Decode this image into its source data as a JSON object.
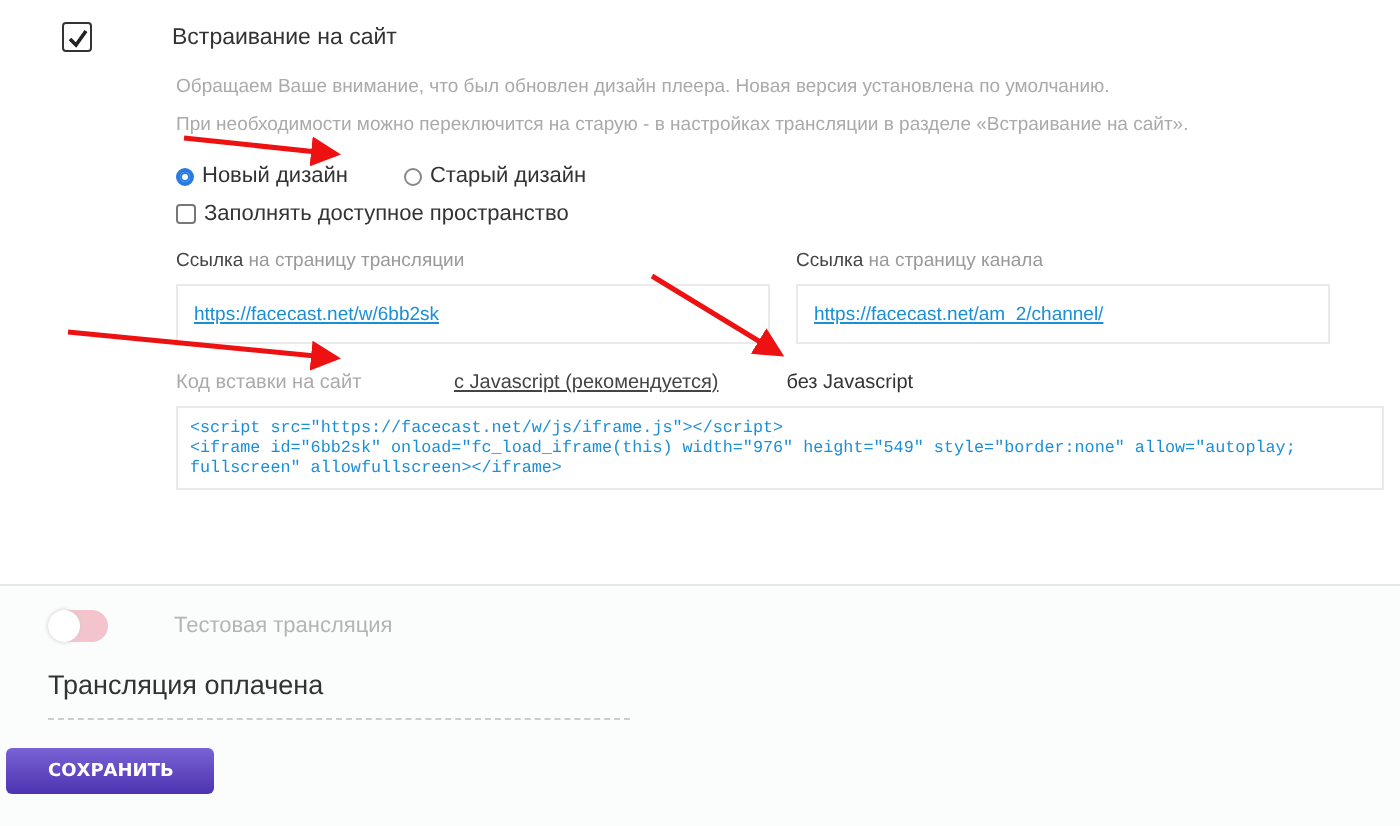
{
  "embed": {
    "checked": true,
    "title": "Встраивание на сайт",
    "notes": [
      "Обращаем Ваше внимание, что был обновлен дизайн плеера. Новая версия установлена по умолчанию.",
      "При необходимости можно переключится на старую - в настройках трансляции в разделе «Встраивание на сайт»."
    ],
    "design_options": [
      {
        "label": "Новый дизайн",
        "selected": true
      },
      {
        "label": "Старый дизайн",
        "selected": false
      }
    ],
    "fill_space": {
      "label": "Заполнять доступное пространство",
      "checked": false
    },
    "links": [
      {
        "label": "Ссылка",
        "label_hint": "на страницу трансляции",
        "url": "https://facecast.net/w/6bb2sk"
      },
      {
        "label": "Ссылка",
        "label_hint": "на страницу канала",
        "url": "https://facecast.net/am_2/channel/"
      }
    ],
    "code_label": "Код вставки на сайт",
    "code_tabs": [
      {
        "label": "с Javascript (рекомендуется)",
        "selected": false
      },
      {
        "label": "без Javascript",
        "selected": true
      }
    ],
    "code_lines": [
      "<script src=\"https://facecast.net/w/js/iframe.js\"></script>",
      "<iframe id=\"6bb2sk\" onload=\"fc_load_iframe(this) width=\"976\" height=\"549\" style=\"border:none\" allow=\"autoplay; fullscreen\" allowfullscreen></iframe>"
    ]
  },
  "test_stream": {
    "label": "Тестовая трансляция",
    "on": false
  },
  "paid": {
    "label": "Трансляция оплачена"
  },
  "save_button": "СОХРАНИТЬ"
}
